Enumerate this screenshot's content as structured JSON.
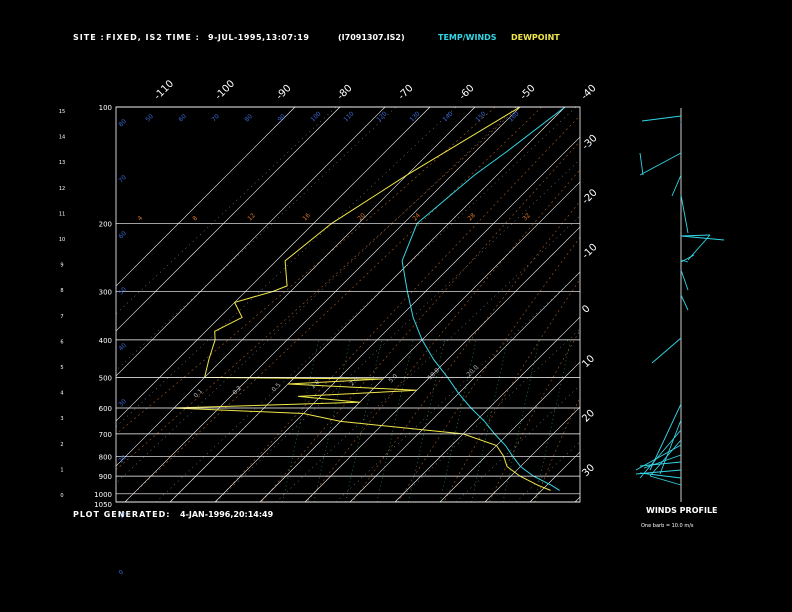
{
  "header": {
    "site_label": "SITE :",
    "site_value": "FIXED, IS2",
    "time_label": "TIME :",
    "time_value": "9-JUL-1995,13:07:19",
    "file_value": "(I7091307.IS2)",
    "temp_winds_label": "TEMP/WINDS",
    "dewpoint_label": "DEWPOINT"
  },
  "footer": {
    "generated_label": "PLOT GENERATED:",
    "generated_value": "4-JAN-1996,20:14:49",
    "winds_profile_label": "WINDS PROFILE",
    "winds_note": "One barb = 10.0 m/s"
  },
  "colors": {
    "background": "#000000",
    "text": "#ffffff",
    "temp": "#33d6e6",
    "dewpoint": "#f0e64a",
    "grid": "#ffffff",
    "dry_adiabat": "#ffffff",
    "moist_adiabat": "#e07a2a",
    "mixing_ratio": "#2aa26a",
    "blue_label": "#3a6bd8"
  },
  "chart_data": {
    "type": "skew-t log-p sounding",
    "pressure_levels": [
      100,
      200,
      300,
      400,
      500,
      600,
      700,
      800,
      900,
      1000,
      1050
    ],
    "km_ticks": [
      "15",
      "14",
      "13",
      "12",
      "11",
      "10",
      "9",
      "8",
      "7",
      "6",
      "5",
      "4",
      "3",
      "2",
      "1",
      "0"
    ],
    "top_temp_ticks": [
      "-110",
      "-100",
      "-90",
      "-80",
      "-70",
      "-60",
      "-50",
      "-40"
    ],
    "right_temp_ticks": [
      "-30",
      "-20",
      "-10",
      "0",
      "10",
      "20",
      "30"
    ],
    "left_theta_labels": [
      "80",
      "70",
      "60",
      "50",
      "40",
      "30",
      "20",
      "10",
      "0"
    ],
    "top_theta_labels": [
      "50",
      "60",
      "70",
      "80",
      "90",
      "100",
      "110",
      "120",
      "130",
      "140",
      "150",
      "160"
    ],
    "moist_labels": [
      "4",
      "8",
      "12",
      "16",
      "20",
      "24",
      "28",
      "32"
    ],
    "mixing_labels": [
      "0.1",
      "0.2",
      "0.5",
      "1.0",
      "2.0",
      "5.0",
      "10.0",
      "20.0"
    ],
    "series": [
      {
        "name": "TEMP/WINDS",
        "p": [
          100,
          130,
          150,
          200,
          250,
          300,
          350,
          400,
          450,
          500,
          550,
          600,
          650,
          700,
          750,
          800,
          850,
          900,
          950,
          980
        ],
        "t": [
          -70,
          -73,
          -75,
          -77,
          -72,
          -64,
          -57,
          -50,
          -43,
          -36,
          -30,
          -24,
          -18,
          -13,
          -8,
          -4,
          0,
          5,
          11,
          14
        ]
      },
      {
        "name": "DEWPOINT",
        "p": [
          100,
          150,
          200,
          250,
          290,
          300,
          320,
          350,
          380,
          400,
          450,
          500,
          505,
          520,
          540,
          560,
          580,
          600,
          620,
          650,
          700,
          750,
          800,
          850,
          900,
          950,
          980
        ],
        "t": [
          -80,
          -90,
          -96,
          -98,
          -92,
          -94,
          -100,
          -95,
          -98,
          -96,
          -93,
          -90,
          -50,
          -70,
          -40,
          -65,
          -50,
          -90,
          -60,
          -50,
          -20,
          -10,
          -6,
          -3,
          2,
          8,
          12
        ]
      }
    ],
    "winds": {
      "unit": "m/s",
      "barb_value": 10.0
    }
  }
}
